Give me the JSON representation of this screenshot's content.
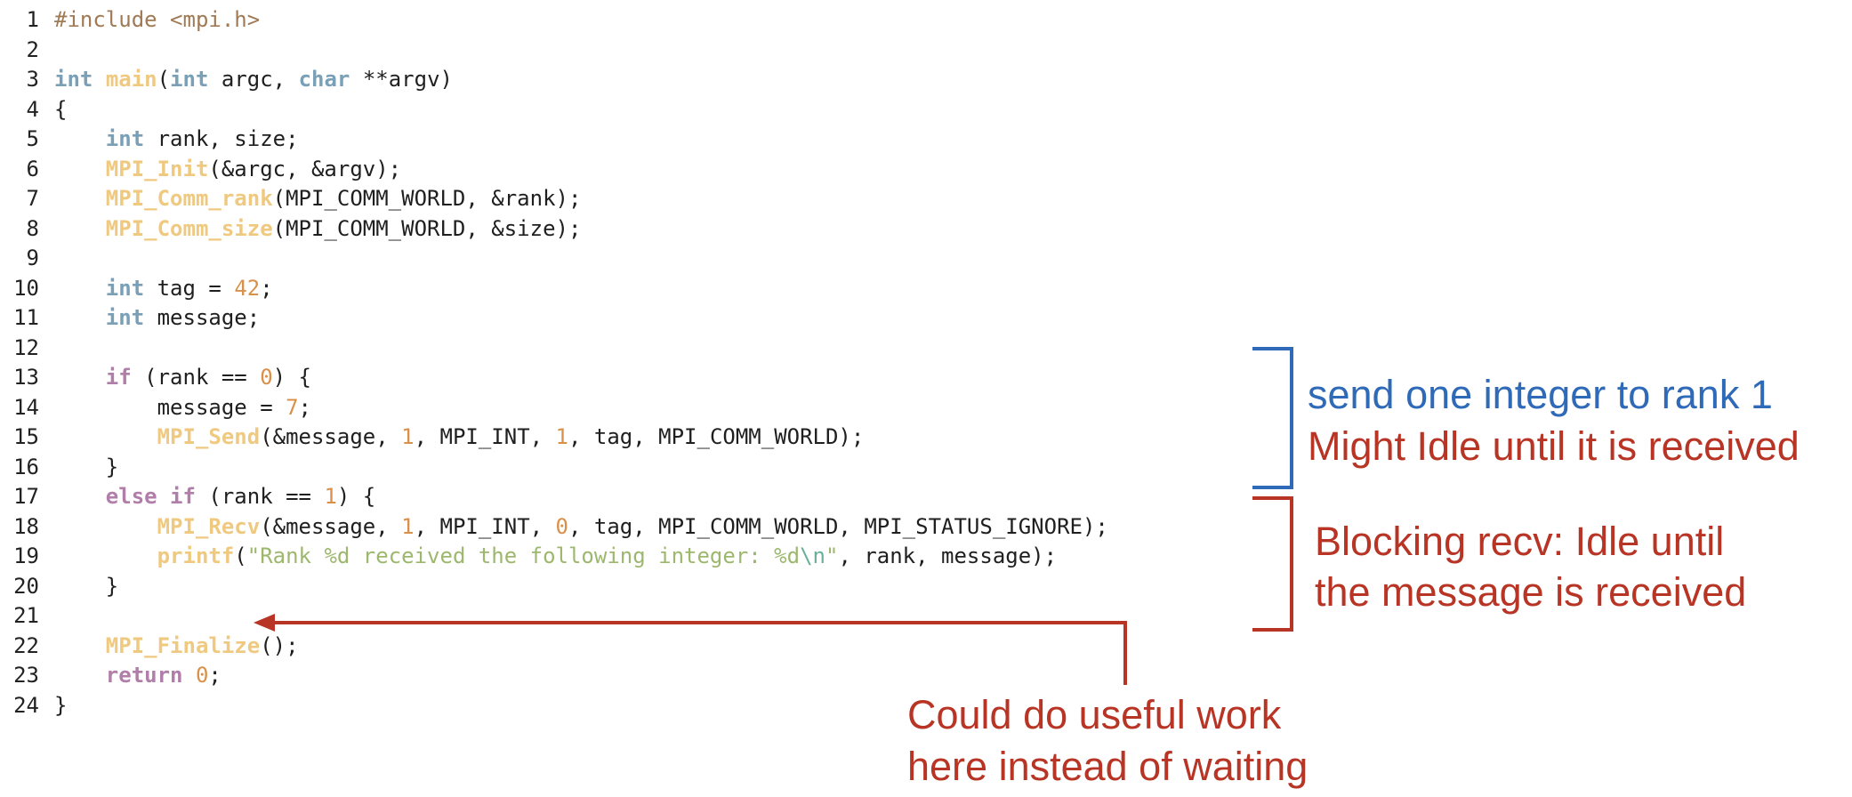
{
  "code": {
    "line_numbers": [
      "1",
      "2",
      "3",
      "4",
      "5",
      "6",
      "7",
      "8",
      "9",
      "10",
      "11",
      "12",
      "13",
      "14",
      "15",
      "16",
      "17",
      "18",
      "19",
      "20",
      "21",
      "22",
      "23",
      "24"
    ],
    "tokens": {
      "l1_pre": "#include <mpi.h>",
      "l3_int": "int",
      "l3_main": "main",
      "l3_paren": "(",
      "l3_int2": "int",
      "l3_argc": " argc, ",
      "l3_char": "char",
      "l3_rest": " **argv)",
      "l4": "{",
      "l5_int": "int",
      "l5_rest": " rank, size;",
      "l6_fn": "MPI_Init",
      "l6_rest": "(&argc, &argv);",
      "l7_fn": "MPI_Comm_rank",
      "l7_rest": "(MPI_COMM_WORLD, &rank);",
      "l8_fn": "MPI_Comm_size",
      "l8_rest": "(MPI_COMM_WORLD, &size);",
      "l10_int": "int",
      "l10_a": " tag = ",
      "l10_num": "42",
      "l10_b": ";",
      "l11_int": "int",
      "l11_rest": " message;",
      "l13_if": "if",
      "l13_a": " (rank == ",
      "l13_num": "0",
      "l13_b": ") {",
      "l14_a": "message = ",
      "l14_num": "7",
      "l14_b": ";",
      "l15_fn": "MPI_Send",
      "l15_a": "(&message, ",
      "l15_n1": "1",
      "l15_b": ", MPI_INT, ",
      "l15_n2": "1",
      "l15_c": ", tag, MPI_COMM_WORLD);",
      "l16": "}",
      "l17_else": "else",
      "l17_sp": " ",
      "l17_if": "if",
      "l17_a": " (rank == ",
      "l17_num": "1",
      "l17_b": ") {",
      "l18_fn": "MPI_Recv",
      "l18_a": "(&message, ",
      "l18_n1": "1",
      "l18_b": ", MPI_INT, ",
      "l18_n2": "0",
      "l18_c": ", tag, MPI_COMM_WORLD, MPI_STATUS_IGNORE);",
      "l19_fn": "printf",
      "l19_a": "(",
      "l19_str": "\"Rank %d received the following integer: %d",
      "l19_esc": "\\n",
      "l19_str2": "\"",
      "l19_b": ", rank, message);",
      "l20": "}",
      "l22_fn": "MPI_Finalize",
      "l22_rest": "();",
      "l23_ret": "return",
      "l23_sp": " ",
      "l23_num": "0",
      "l23_b": ";",
      "l24": "}"
    }
  },
  "annotations": {
    "send_line1": "send one integer to rank 1",
    "send_line2": "Might Idle until it is received",
    "recv_line1": "Blocking recv: Idle until",
    "recv_line2": "the message is received",
    "work_line1": "Could do useful work",
    "work_line2": "here instead of waiting"
  },
  "colors": {
    "annotation_blue": "#2f6ab8",
    "annotation_red": "#b83526",
    "keyword_type": "#7aa0b8",
    "keyword_control": "#b07ea8",
    "function": "#efc97f",
    "number": "#d9904a",
    "string": "#9db86e",
    "preprocessor": "#a07a55"
  }
}
